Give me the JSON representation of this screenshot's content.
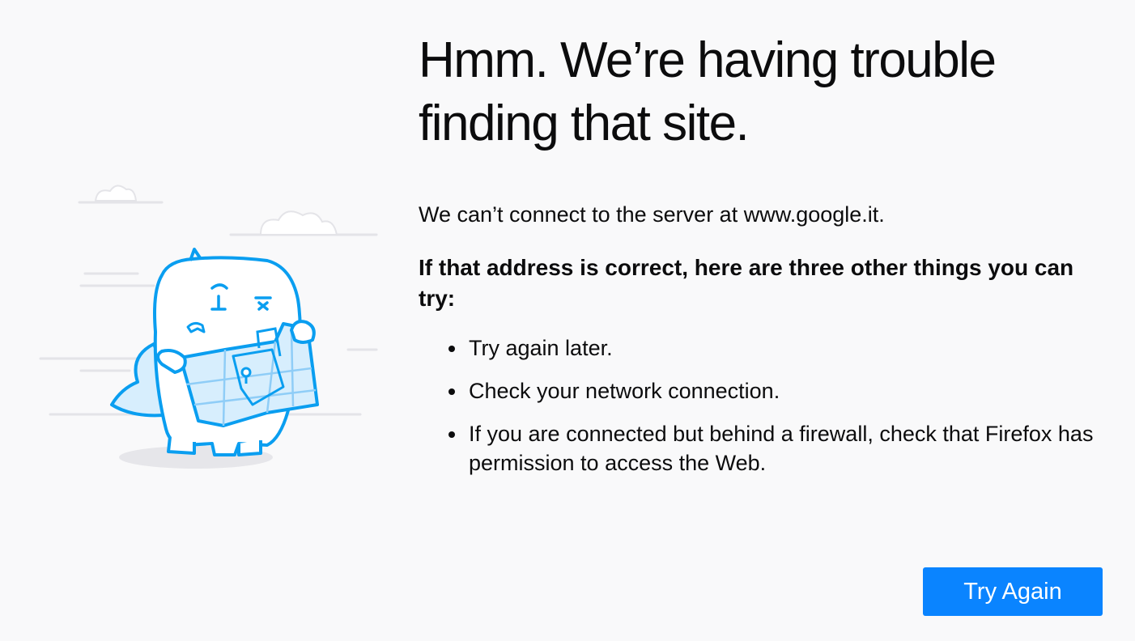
{
  "error": {
    "title": "Hmm. We’re having trouble finding that site.",
    "description": "We can’t connect to the server at www.google.it.",
    "intro": "If that address is correct, here are three other things you can try:",
    "suggestions": [
      "Try again later.",
      "Check your network connection.",
      "If you are connected but behind a firewall, check that Firefox has permission to access the Web."
    ],
    "try_again_label": "Try Again",
    "accent_color": "#0a84ff",
    "illustration_color": "#0a9ef0",
    "illustration": "confused-monster-with-map-illustration"
  }
}
